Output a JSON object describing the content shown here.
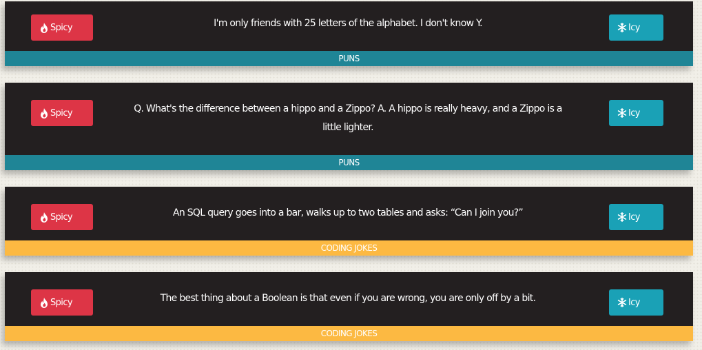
{
  "colors": {
    "spicy": "#dd3546",
    "icy": "#1aa1b6",
    "card": "#231f20",
    "puns_tag": "#1f8596",
    "coding_tag": "#fcb942"
  },
  "buttons": {
    "spicy_label": "Spicy",
    "spicy_icon": "flame-icon",
    "icy_label": "Icy",
    "icy_icon": "snowflake-icon"
  },
  "jokes": [
    {
      "text": "I'm only friends with 25 letters of the alphabet. I don't know Y.",
      "category": "PUNS"
    },
    {
      "text": "Q. What's the difference between a hippo and a Zippo? A. A hippo is really heavy, and a Zippo is a little lighter.",
      "category": "PUNS"
    },
    {
      "text": "An SQL query goes into a bar, walks up to two tables and asks: “Can I join you?”",
      "category": "CODING JOKES"
    },
    {
      "text": "The best thing about a Boolean is that even if you are wrong, you are only off by a bit.",
      "category": "CODING JOKES"
    }
  ]
}
